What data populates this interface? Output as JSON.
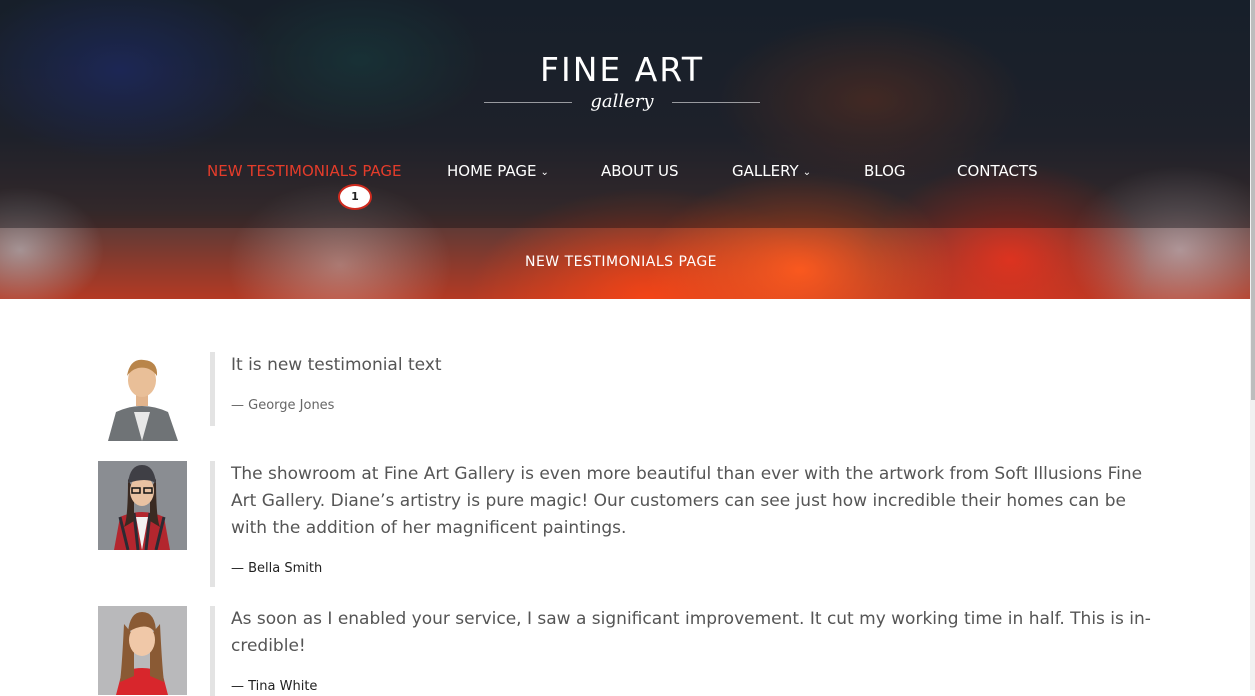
{
  "logo": {
    "title": "FINE ART",
    "subtitle": "gallery"
  },
  "nav": {
    "items": [
      {
        "label": "NEW TESTIMONIALS PAGE",
        "active": true,
        "dropdown": false
      },
      {
        "label": "HOME PAGE",
        "active": false,
        "dropdown": true
      },
      {
        "label": "ABOUT US",
        "active": false,
        "dropdown": false
      },
      {
        "label": "GALLERY",
        "active": false,
        "dropdown": true
      },
      {
        "label": "BLOG",
        "active": false,
        "dropdown": false
      },
      {
        "label": "CONTACTS",
        "active": false,
        "dropdown": false
      }
    ],
    "badge": "1"
  },
  "page_title": "NEW TESTIMONIALS PAGE",
  "testimonials": [
    {
      "text": "It is new testimonial text",
      "author": "— George Jones"
    },
    {
      "text": "The showroom at Fine Art Gallery is even more beautiful than ever with the artwork from Soft Illusions Fine Art Gallery. Diane’s artistry is pure magic! Our customers can see just how incredible their homes can be with the addition of her magnificent paintings.",
      "author": "— Bella Smith"
    },
    {
      "text": "As soon as I enabled your service, I saw a significant improvement. It cut my working time in half. This is in­credible!",
      "author": "— Tina White"
    }
  ],
  "colors": {
    "accent": "#e53c2a",
    "badge_border": "#cf2a1e"
  }
}
